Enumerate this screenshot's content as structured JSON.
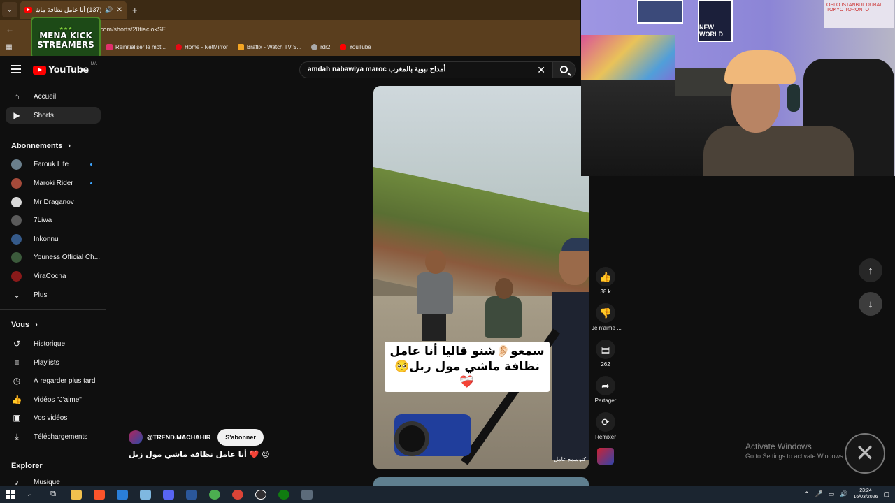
{
  "browser": {
    "tab_title": "(137) أنا عامل نظافة ماشي مـ...",
    "url": "com/shorts/20tiaciokSE",
    "bookmarks": [
      {
        "label": "Réinitialiser le mot...",
        "color": "#e1306c"
      },
      {
        "label": "Home - NetMirror",
        "color": "#e50914"
      },
      {
        "label": "Braflix - Watch TV S...",
        "color": "#f5a623"
      },
      {
        "label": "rdr2",
        "color": "#aaaaaa"
      },
      {
        "label": "YouTube",
        "color": "#ff0000"
      }
    ]
  },
  "overlay_logo": {
    "line1": "MENA KICK",
    "line2": "STREAMERS",
    "stars": "★★★"
  },
  "youtube": {
    "logo_text": "YouTube",
    "country": "MA",
    "search_query": "amdah nabawiya maroc أمداح نبوية بالمغرب"
  },
  "sidebar": {
    "main": [
      {
        "label": "Accueil",
        "icon": "home-icon"
      },
      {
        "label": "Shorts",
        "icon": "shorts-icon",
        "active": true
      }
    ],
    "subscriptions_title": "Abonnements",
    "subscriptions": [
      {
        "label": "Farouk Life",
        "color": "#6a7f8c",
        "new": true
      },
      {
        "label": "Maroki Rider",
        "color": "#a44a3a",
        "new": true
      },
      {
        "label": "Mr Draganov",
        "color": "#d8d8d8",
        "new": false
      },
      {
        "label": "7Liwa",
        "color": "#5a5a5a",
        "new": false
      },
      {
        "label": "Inkonnu",
        "color": "#355a8a",
        "new": false
      },
      {
        "label": "Youness Official Ch...",
        "color": "#3b5a3b",
        "new": false
      },
      {
        "label": "ViraCocha",
        "color": "#8a1a1a",
        "new": false
      }
    ],
    "more_label": "Plus",
    "you_title": "Vous",
    "you_items": [
      {
        "label": "Historique",
        "icon": "history-icon"
      },
      {
        "label": "Playlists",
        "icon": "playlists-icon"
      },
      {
        "label": "À regarder plus tard",
        "icon": "watch-later-icon"
      },
      {
        "label": "Vidéos \"J'aime\"",
        "icon": "liked-videos-icon"
      },
      {
        "label": "Vos vidéos",
        "icon": "your-videos-icon"
      },
      {
        "label": "Téléchargements",
        "icon": "downloads-icon"
      }
    ],
    "explore_title": "Explorer",
    "explore_items": [
      {
        "label": "Musique",
        "icon": "music-icon"
      }
    ]
  },
  "short": {
    "caption_line1": "سمعو👂🏻شنو قاليا أنا عامل",
    "caption_line2": "نظافة ماشي مول زبل🥺❤️‍🩹",
    "corner_text": "كنوسمع عامل",
    "channel_name": "@TREND.MACHAHIR",
    "subscribe_label": "S'abonner",
    "title": "أنا عامل نظافة ماشي مول زبل ❤️ 😍"
  },
  "actions": [
    {
      "name": "like",
      "label": "38 k",
      "icon": "thumbs-up-icon"
    },
    {
      "name": "dislike",
      "label": "Je n'aime ...",
      "icon": "thumbs-down-icon"
    },
    {
      "name": "comments",
      "label": "262",
      "icon": "comment-icon"
    },
    {
      "name": "share",
      "label": "Partager",
      "icon": "share-icon"
    },
    {
      "name": "remix",
      "label": "Remixer",
      "icon": "remix-icon"
    }
  ],
  "activation": {
    "title": "Activate Windows",
    "subtitle": "Go to Settings to activate Windows."
  },
  "webcam": {
    "poster_text": "NEW WORLD",
    "banner_text": "OSLO ISTANBUL DUBAI TOKYO TORONTO"
  },
  "taskbar": {
    "time": "23:24",
    "date": "16/03/2026"
  }
}
